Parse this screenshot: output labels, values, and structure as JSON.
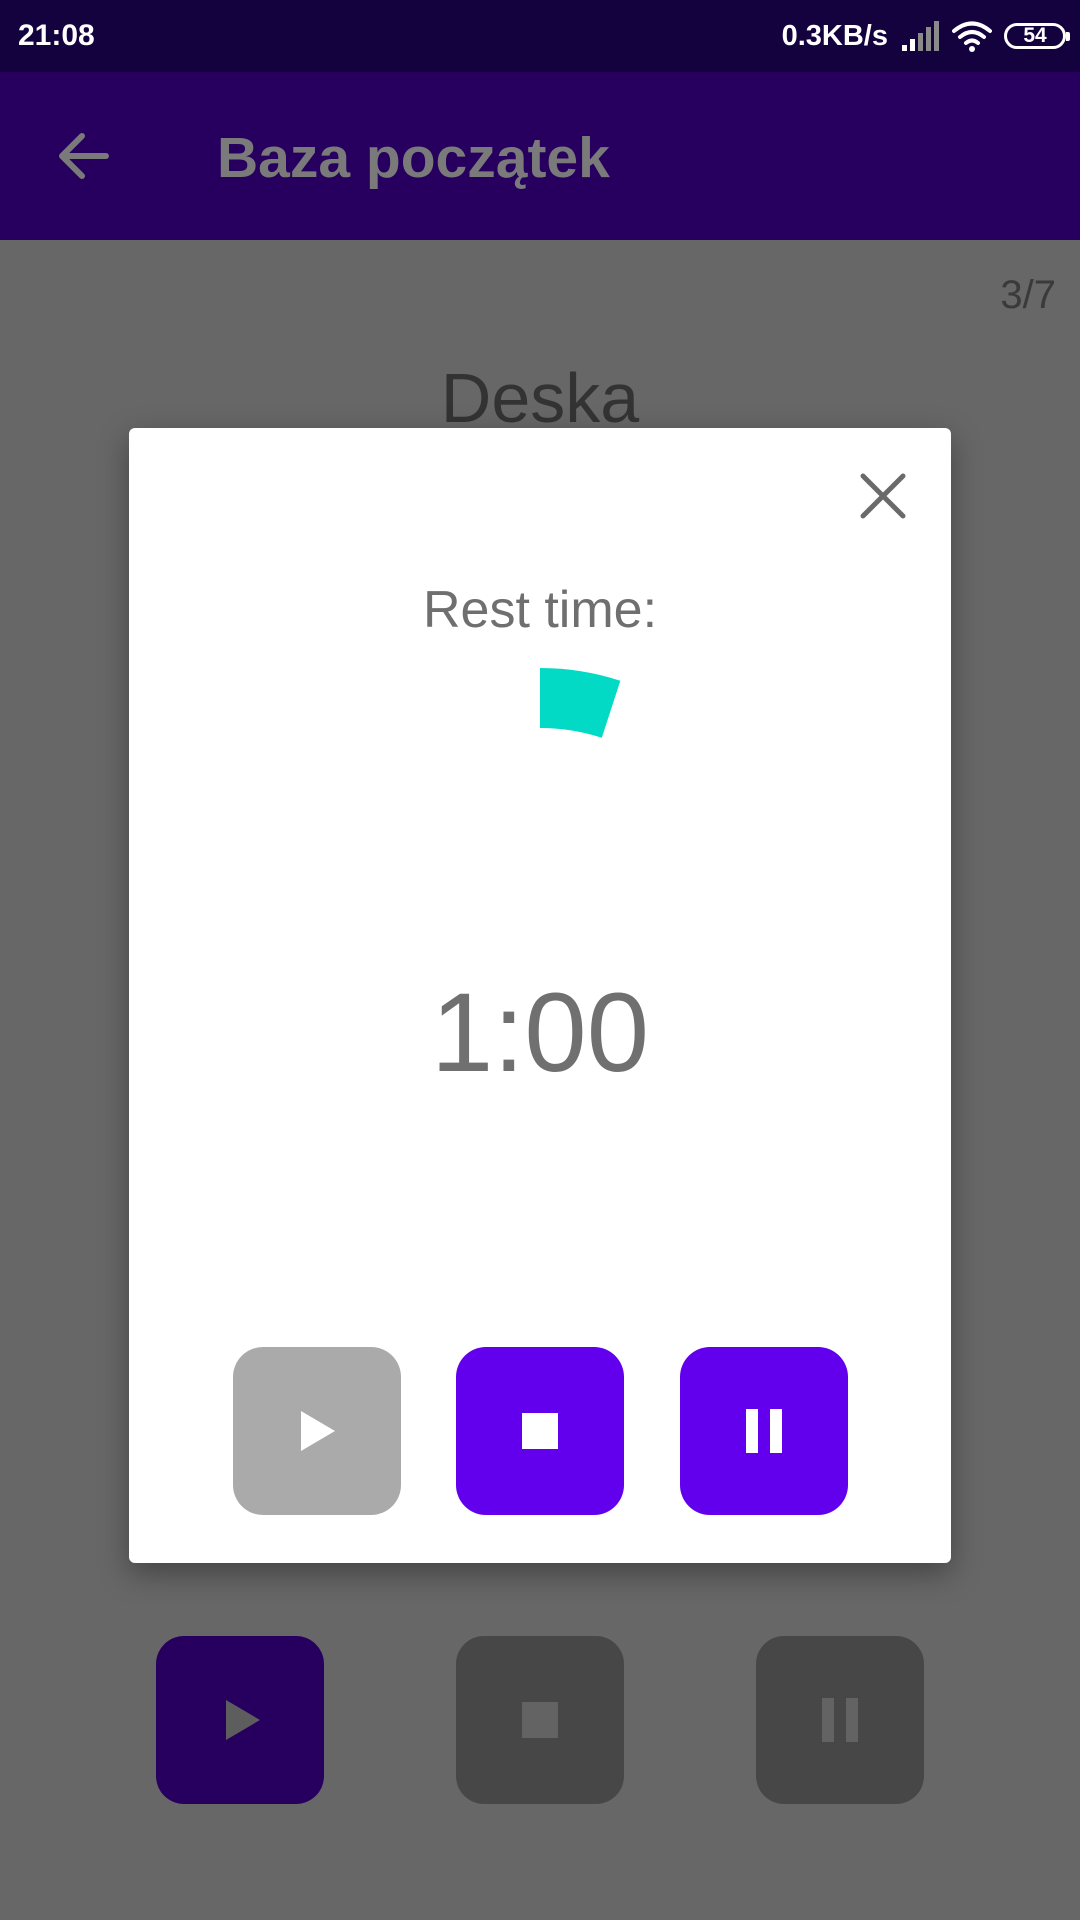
{
  "status_bar": {
    "time": "21:08",
    "network_speed": "0.3KB/s",
    "battery_level": "54",
    "icons": [
      "signal-icon",
      "wifi-icon",
      "battery-icon"
    ]
  },
  "toolbar": {
    "back_icon": "arrow-left-icon",
    "title": "Baza początek"
  },
  "screen": {
    "progress_counter": "3/7",
    "exercise_title": "Deska",
    "controls": [
      {
        "icon": "play-icon",
        "color": "#27005f"
      },
      {
        "icon": "stop-icon",
        "color": "#474747"
      },
      {
        "icon": "pause-icon",
        "color": "#474747"
      }
    ]
  },
  "dialog": {
    "close_icon": "close-icon",
    "label": "Rest time:",
    "timer": "1:00",
    "progress_fraction": 0.05,
    "progress_color": "#03dac5",
    "controls": [
      {
        "icon": "play-icon",
        "enabled": false,
        "color": "#aaaaaa"
      },
      {
        "icon": "stop-icon",
        "enabled": true,
        "color": "#6200ee"
      },
      {
        "icon": "pause-icon",
        "enabled": true,
        "color": "#6200ee"
      }
    ]
  },
  "colors": {
    "primary": "#6200ee",
    "primary_dark": "#14023f",
    "scrim_background": "#676767"
  }
}
